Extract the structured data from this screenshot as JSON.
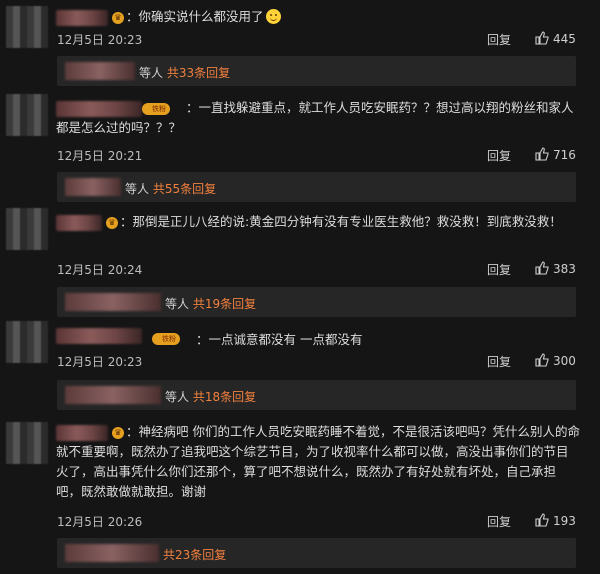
{
  "comments": [
    {
      "text": "：你确实说什么都没用了",
      "date": "12月5日 20:23",
      "reply_label": "回复",
      "likes": "445",
      "replies_prefix": "等人",
      "replies_count": "共33条回复",
      "badge_icon": "crown-badge-icon"
    },
    {
      "text": "：一直找躲避重点，就工作人员吃安眠药？？想过高以翔的粉丝和家人都是怎么过的吗？？？",
      "date": "12月5日 20:21",
      "reply_label": "回复",
      "likes": "716",
      "replies_prefix": "等人",
      "replies_count": "共55条回复",
      "badge_text": "铁粉"
    },
    {
      "text": "：那倒是正儿八经的说:黄金四分钟有没有专业医生救他？救没救！到底救没救！",
      "date": "12月5日 20:24",
      "reply_label": "回复",
      "likes": "383",
      "replies_prefix": "等人",
      "replies_count": "共19条回复",
      "badge_icon": "crown-badge-icon"
    },
    {
      "text": "：一点诚意都没有  一点都没有",
      "date": "12月5日 20:23",
      "reply_label": "回复",
      "likes": "300",
      "replies_prefix": "等人",
      "replies_count": "共18条回复",
      "badge_text": "铁粉"
    },
    {
      "text": "：神经病吧  你们的工作人员吃安眠药睡不着觉，不是很活该吧吗？凭什么别人的命就不重要啊，既然办了追我吧这个综艺节目，为了收视率什么都可以做，高没出事你们的节目火了，高出事凭什么你们还那个，算了吧不想说什么，既然办了有好处就有坏处，自己承担吧，既然敢做就敢担。谢谢",
      "date": "12月5日 20:26",
      "reply_label": "回复",
      "likes": "193",
      "replies_prefix": "",
      "replies_count": "共23条回复",
      "badge_icon": "crown-badge-icon"
    }
  ],
  "colors": {
    "background": "#151515",
    "reply_count": "#f2803e",
    "reply_bar": "#262626"
  }
}
